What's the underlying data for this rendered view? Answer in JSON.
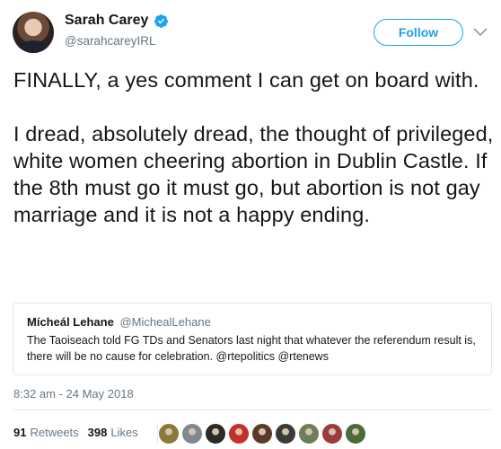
{
  "user": {
    "name": "Sarah Carey",
    "handle": "@sarahcareyIRL",
    "verified": true
  },
  "follow_label": "Follow",
  "tweet_text": "FINALLY, a yes comment I can get on board with.\n\nI dread, absolutely dread, the thought of privileged, white women cheering abortion in Dublin Castle. If the 8th must go it must go, but abortion is not gay marriage and it is not a happy ending.",
  "quoted_tweet": {
    "name": "Mícheál Lehane",
    "handle": "@MichealLehane",
    "text": "The Taoiseach told FG TDs and Senators last night that whatever the referendum result is,  there will be no cause for celebration. @rtepolitics @rtenews"
  },
  "timestamp": "8:32 am - 24 May 2018",
  "stats": {
    "retweets_count": "91",
    "retweets_label": "Retweets",
    "likes_count": "398",
    "likes_label": "Likes"
  },
  "likers": [
    {
      "icon": "liker-avatar",
      "color": "#8a7a3a"
    },
    {
      "icon": "liker-avatar",
      "color": "#7d8a8f"
    },
    {
      "icon": "liker-avatar",
      "color": "#2a2a2a"
    },
    {
      "icon": "liker-avatar",
      "color": "#c4302b"
    },
    {
      "icon": "liker-avatar",
      "color": "#5a3b2a"
    },
    {
      "icon": "liker-avatar",
      "color": "#3a3a3a"
    },
    {
      "icon": "liker-avatar",
      "color": "#6b7f5a"
    },
    {
      "icon": "liker-avatar",
      "color": "#9b3b3b"
    },
    {
      "icon": "liker-avatar",
      "color": "#4d6b3a"
    }
  ],
  "colors": {
    "accent": "#1da1f2",
    "secondary_text": "#657786",
    "border": "#e1e8ed"
  }
}
